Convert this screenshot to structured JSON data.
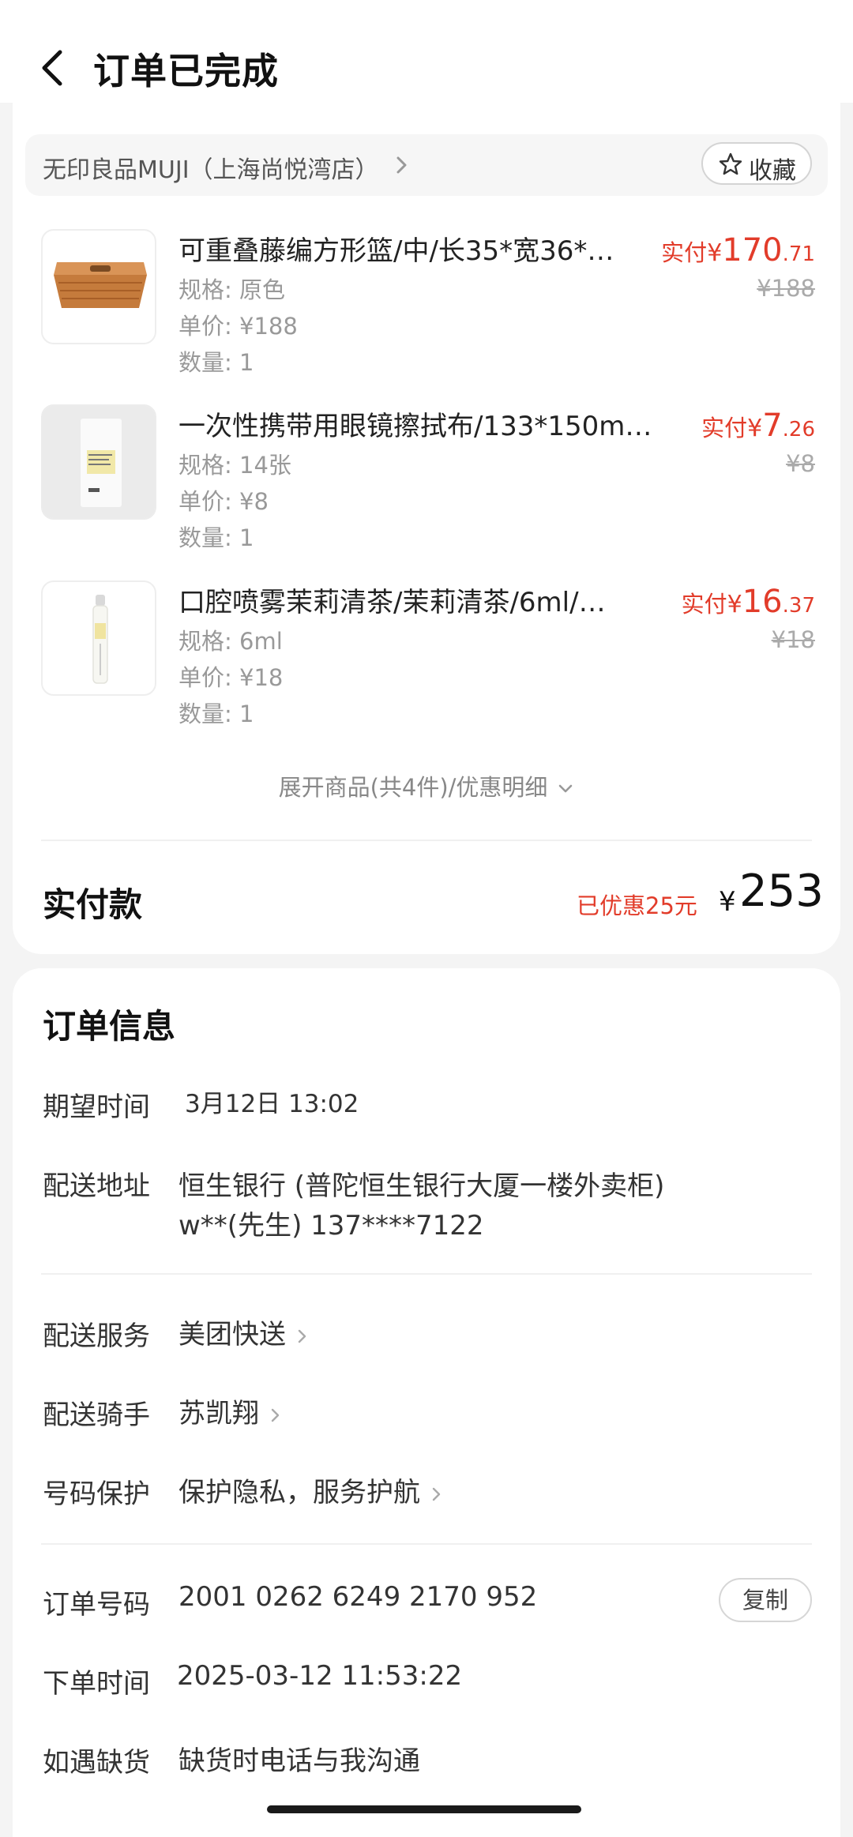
{
  "header": {
    "title": "订单已完成"
  },
  "store": {
    "name": "无印良品MUJI（上海尚悦湾店）",
    "fav_label": "收藏"
  },
  "items": [
    {
      "name": "可重叠藤编方形篮/中/长35*宽36*…",
      "spec": "规格: 原色",
      "unit_price": "单价: ¥188",
      "qty": "数量: 1",
      "paid_label": "实付",
      "paid_currency": "¥",
      "paid_int": "170",
      "paid_dec": ".71",
      "orig": "¥188"
    },
    {
      "name": "一次性携带用眼镜擦拭布/133*150m…",
      "spec": "规格: 14张",
      "unit_price": "单价: ¥8",
      "qty": "数量: 1",
      "paid_label": "实付",
      "paid_currency": "¥",
      "paid_int": "7",
      "paid_dec": ".26",
      "orig": "¥8"
    },
    {
      "name": "口腔喷雾茉莉清茶/茉莉清茶/6ml/…",
      "spec": "规格: 6ml",
      "unit_price": "单价: ¥18",
      "qty": "数量: 1",
      "paid_label": "实付",
      "paid_currency": "¥",
      "paid_int": "16",
      "paid_dec": ".37",
      "orig": "¥18"
    }
  ],
  "expand_label": "展开商品(共4件)/优惠明细",
  "payment": {
    "label": "实付款",
    "saved": "已优惠25元",
    "currency": "¥",
    "total": "253"
  },
  "order_info": {
    "title": "订单信息",
    "expected_time": {
      "label": "期望时间",
      "value": "3月12日 13:02"
    },
    "address": {
      "label": "配送地址",
      "line1": "恒生银行 (普陀恒生银行大厦一楼外卖柜)",
      "line2": "w**(先生) 137****7122"
    },
    "service": {
      "label": "配送服务",
      "value": "美团快送"
    },
    "rider": {
      "label": "配送骑手",
      "value": "苏凯翔"
    },
    "privacy": {
      "label": "号码保护",
      "value": "保护隐私，服务护航"
    },
    "order_no": {
      "label": "订单号码",
      "value": "2001 0262 6249 2170 952",
      "copy_label": "复制"
    },
    "order_time": {
      "label": "下单时间",
      "value": "2025-03-12 11:53:22"
    },
    "out_of_stock": {
      "label": "如遇缺货",
      "value": "缺货时电话与我沟通"
    }
  },
  "colors": {
    "accent_red": "#e23c2a",
    "text_dark": "#222222",
    "text_gray": "#999999"
  }
}
